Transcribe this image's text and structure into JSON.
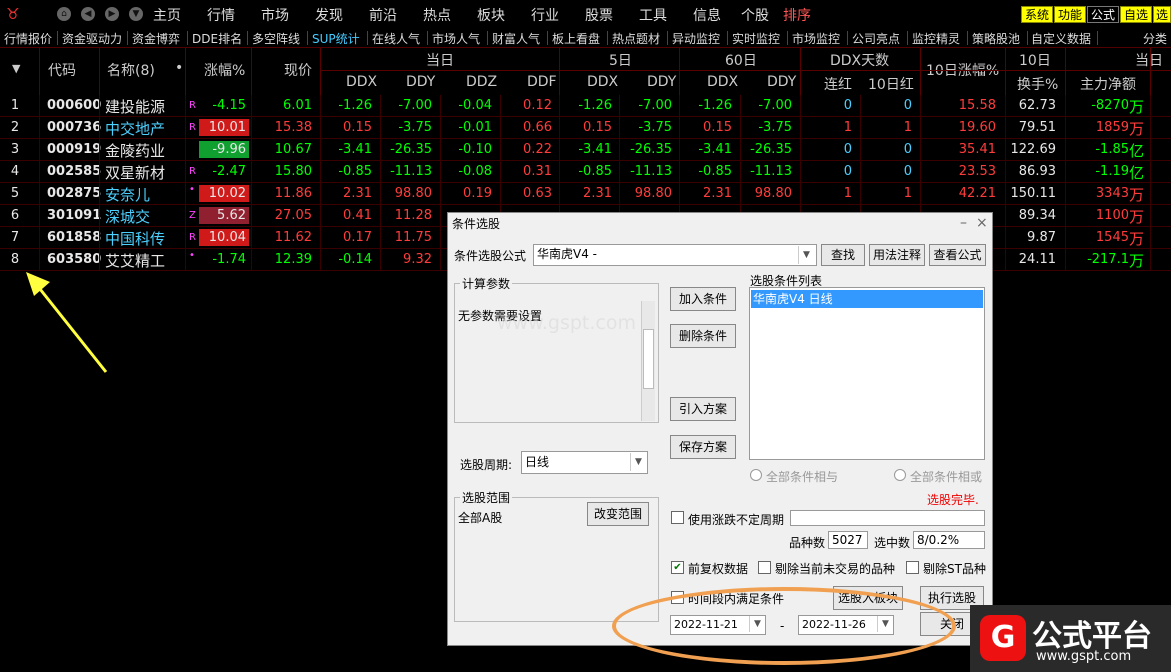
{
  "menubar": {
    "logo": "♉",
    "home": "主页",
    "items": [
      "行情",
      "市场",
      "发现",
      "前沿",
      "热点",
      "板块",
      "行业",
      "股票",
      "工具",
      "信息",
      "个股",
      "排序"
    ],
    "right": [
      "系统",
      "功能",
      "公式",
      "自选",
      "选股"
    ]
  },
  "tabs": [
    "行情报价",
    "资金驱动力",
    "资金博弈",
    "DDE排名",
    "多空阵线",
    "SUP统计",
    "在线人气",
    "市场人气",
    "财富人气",
    "板上看盘",
    "热点题材",
    "异动监控",
    "实时监控",
    "市场监控",
    "公司亮点",
    "监控精灵",
    "策略股池",
    "自定义数据",
    "分类"
  ],
  "header": {
    "code": "代码",
    "name": "名称(8)",
    "dot": "•",
    "change": "涨幅%",
    "price": "现价",
    "group_today": "当日",
    "group_5d": "5日",
    "group_60d": "60日",
    "group_ddx_days": "DDX天数",
    "ten_day_change": "10日涨幅%",
    "group_10d": "10日",
    "turnover": "换手%",
    "group_today2": "当日",
    "main_net": "主力净额",
    "ddx": "DDX",
    "ddy": "DDY",
    "ddz": "DDZ",
    "ddf": "DDF",
    "consec_red": "连红",
    "ten_red": "10日红"
  },
  "rows": [
    {
      "n": "1",
      "code": "000600",
      "name": "建投能源",
      "mark": "R",
      "chg": "-4.15",
      "price": "6.01",
      "ddx": "-1.26",
      "ddy": "-7.00",
      "ddz": "-0.04",
      "ddf": "0.12",
      "ddx5": "-1.26",
      "ddy5": "-7.00",
      "ddx60": "-1.26",
      "ddy60": "-7.00",
      "red": "0",
      "red10": "0",
      "c10": "15.58",
      "turn": "62.73",
      "net": "-8270",
      "unit": "万"
    },
    {
      "n": "2",
      "code": "000736",
      "name": "中交地产",
      "mark": "R",
      "chg": "10.01",
      "price": "15.38",
      "ddx": "0.15",
      "ddy": "-3.75",
      "ddz": "-0.01",
      "ddf": "0.66",
      "ddx5": "0.15",
      "ddy5": "-3.75",
      "ddx60": "0.15",
      "ddy60": "-3.75",
      "red": "1",
      "red10": "1",
      "c10": "19.60",
      "turn": "79.51",
      "net": "1859",
      "unit": "万"
    },
    {
      "n": "3",
      "code": "000919",
      "name": "金陵药业",
      "mark": "",
      "chg": "-9.96",
      "price": "10.67",
      "ddx": "-3.41",
      "ddy": "-26.35",
      "ddz": "-0.10",
      "ddf": "0.22",
      "ddx5": "-3.41",
      "ddy5": "-26.35",
      "ddx60": "-3.41",
      "ddy60": "-26.35",
      "red": "0",
      "red10": "0",
      "c10": "35.41",
      "turn": "122.69",
      "net": "-1.85",
      "unit": "亿"
    },
    {
      "n": "4",
      "code": "002585",
      "name": "双星新材",
      "mark": "R",
      "chg": "-2.47",
      "price": "15.80",
      "ddx": "-0.85",
      "ddy": "-11.13",
      "ddz": "-0.08",
      "ddf": "0.31",
      "ddx5": "-0.85",
      "ddy5": "-11.13",
      "ddx60": "-0.85",
      "ddy60": "-11.13",
      "red": "0",
      "red10": "0",
      "c10": "23.53",
      "turn": "86.93",
      "net": "-1.19",
      "unit": "亿"
    },
    {
      "n": "5",
      "code": "002875",
      "name": "安奈儿",
      "mark": "•",
      "chg": "10.02",
      "price": "11.86",
      "ddx": "2.31",
      "ddy": "98.80",
      "ddz": "0.19",
      "ddf": "0.63",
      "ddx5": "2.31",
      "ddy5": "98.80",
      "ddx60": "2.31",
      "ddy60": "98.80",
      "red": "1",
      "red10": "1",
      "c10": "42.21",
      "turn": "150.11",
      "net": "3343",
      "unit": "万"
    },
    {
      "n": "6",
      "code": "301091",
      "name": "深城交",
      "mark": "Z",
      "chg": "5.62",
      "price": "27.05",
      "ddx": "0.41",
      "ddy": "11.28",
      "ddz": "",
      "ddf": "",
      "ddx5": "",
      "ddy5": "",
      "ddx60": "",
      "ddy60": "",
      "red": "",
      "red10": "",
      "c10": "",
      "turn": "89.34",
      "net": "1100",
      "unit": "万"
    },
    {
      "n": "7",
      "code": "601858",
      "name": "中国科传",
      "mark": "R",
      "chg": "10.04",
      "price": "11.62",
      "ddx": "0.17",
      "ddy": "11.75",
      "ddz": "",
      "ddf": "",
      "ddx5": "",
      "ddy5": "",
      "ddx60": "",
      "ddy60": "",
      "red": "",
      "red10": "",
      "c10": "",
      "turn": "9.87",
      "net": "1545",
      "unit": "万"
    },
    {
      "n": "8",
      "code": "603580",
      "name": "艾艾精工",
      "mark": "•",
      "chg": "-1.74",
      "price": "12.39",
      "ddx": "-0.14",
      "ddy": "9.32",
      "ddz": "",
      "ddf": "",
      "ddx5": "",
      "ddy5": "",
      "ddx60": "",
      "ddy60": "",
      "red": "",
      "red10": "",
      "c10": "",
      "turn": "24.11",
      "net": "-217.1",
      "unit": "万"
    }
  ],
  "dialog": {
    "title": "条件选股",
    "formula_label": "条件选股公式",
    "formula_value": "华南虎V4    -",
    "btn_find": "查找",
    "btn_usage": "用法注释",
    "btn_view": "查看公式",
    "calc_params": "计算参数",
    "no_params": "无参数需要设置",
    "btn_add": "加入条件",
    "btn_del": "删除条件",
    "list_label": "选股条件列表",
    "list_item": "华南虎V4  日线",
    "btn_import": "引入方案",
    "btn_save": "保存方案",
    "radio_and": "全部条件相与",
    "radio_or": "全部条件相或",
    "status": "选股完毕.",
    "period_label": "选股周期:",
    "period_value": "日线",
    "range_label": "选股范围",
    "range_value": "全部A股",
    "btn_range": "改变范围",
    "chk_uncertain": "使用涨跌不定周期",
    "count_label": "品种数",
    "count_value": "5027",
    "selected_label": "选中数",
    "selected_value": "8/0.2%",
    "chk_adjust": "前复权数据",
    "chk_exclude_untraded": "剔除当前未交易的品种",
    "chk_exclude_st": "剔除ST品种",
    "chk_period": "时间段内满足条件",
    "btn_to_block": "选股入板块",
    "btn_execute": "执行选股",
    "date_start": "2022-11-21",
    "date_sep": "-",
    "date_end": "2022-11-26",
    "btn_close": "关闭"
  },
  "watermark": {
    "center": "www.gspt.com",
    "brand": "公式平台",
    "url": "www.gspt.com"
  }
}
